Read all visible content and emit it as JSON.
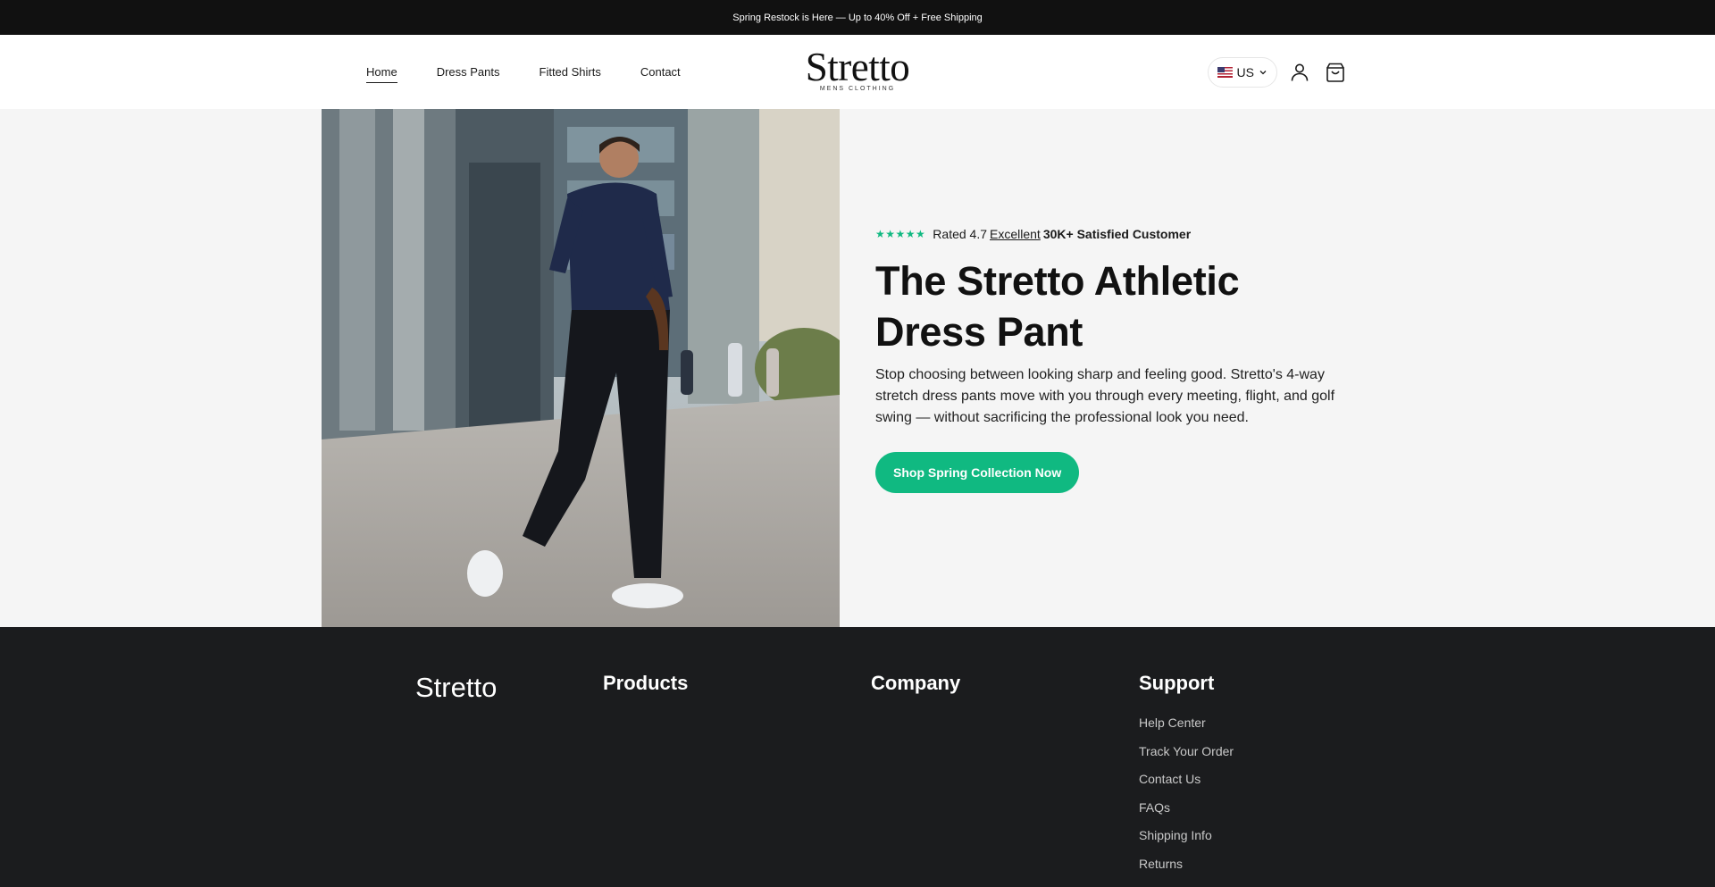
{
  "announcement": "Spring Restock is Here — Up to 40% Off + Free Shipping",
  "nav": [
    {
      "label": "Home",
      "active": true
    },
    {
      "label": "Dress Pants",
      "active": false
    },
    {
      "label": "Fitted Shirts",
      "active": false
    },
    {
      "label": "Contact",
      "active": false
    }
  ],
  "brand": {
    "wordmark": "Stretto",
    "tagline": "MENS CLOTHING"
  },
  "country": {
    "code": "US",
    "flag_icon": "us-flag-icon"
  },
  "header_icons": [
    "account-icon",
    "cart-icon"
  ],
  "hero": {
    "rating_stars": "★★★★★",
    "rating_prefix": "Rated 4.7",
    "rating_label": "Excellent",
    "rating_customers": "30K+ Satisfied Customer",
    "title_line1": "The Stretto Athletic",
    "title_line2": "Dress Pant",
    "description": "Stop choosing between looking sharp and feeling good. Stretto's 4-way stretch dress pants move with you through every meeting, flight, and golf swing — without sacrificing the professional look you need.",
    "cta": "Shop Spring Collection Now"
  },
  "footer": {
    "logo": "Stretto",
    "products_heading": "Products",
    "company_heading": "Company",
    "support_heading": "Support",
    "support_links": [
      "Help Center",
      "Track Your Order",
      "Contact Us",
      "FAQs",
      "Shipping Info",
      "Returns"
    ]
  },
  "colors": {
    "accent": "#10b981",
    "announce_bg": "#111111",
    "footer_bg": "#1b1c1e",
    "hero_bg": "#f5f5f5"
  }
}
